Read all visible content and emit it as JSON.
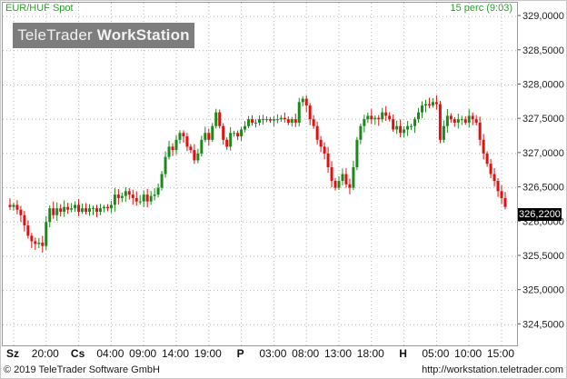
{
  "header": {
    "instrument": "EUR/HUF Spot",
    "interval_time": "15 perc (9:03)"
  },
  "logo": {
    "part1": "TeleTrader ",
    "part2": "WorkStation"
  },
  "footer": {
    "copyright": "© 2019 TeleTrader Software GmbH",
    "url": "http://workstation.teletrader.com"
  },
  "colors": {
    "up": "#1a8a1a",
    "down": "#e01010",
    "grid": "#b4b4b4",
    "accent": "#2e9e2e"
  },
  "chart_data": {
    "type": "candlestick",
    "title": "EUR/HUF Spot",
    "interval": "15 perc",
    "ylim": [
      324.2,
      329.2
    ],
    "ytick_values": [
      324.5,
      325.0,
      325.5,
      326.0,
      326.5,
      327.0,
      327.5,
      328.0,
      328.5,
      329.0
    ],
    "ytick_labels": [
      "324,5000",
      "325,0000",
      "325,5000",
      "326,0000",
      "326,5000",
      "327,0000",
      "327,5000",
      "328,0000",
      "328,5000",
      "329,0000"
    ],
    "last_price": "326,2200",
    "xticks": [
      {
        "label": "Sz",
        "bold": true
      },
      {
        "label": "20:00",
        "bold": false
      },
      {
        "label": "Cs",
        "bold": true
      },
      {
        "label": "04:00",
        "bold": false
      },
      {
        "label": "09:00",
        "bold": false
      },
      {
        "label": "14:00",
        "bold": false
      },
      {
        "label": "19:00",
        "bold": false
      },
      {
        "label": "P",
        "bold": true
      },
      {
        "label": "03:00",
        "bold": false
      },
      {
        "label": "08:00",
        "bold": false
      },
      {
        "label": "13:00",
        "bold": false
      },
      {
        "label": "18:00",
        "bold": false
      },
      {
        "label": "H",
        "bold": true
      },
      {
        "label": "05:00",
        "bold": false
      },
      {
        "label": "10:00",
        "bold": false
      },
      {
        "label": "15:00",
        "bold": false
      }
    ],
    "price_path": [
      326.22,
      326.25,
      326.18,
      326.1,
      325.95,
      325.8,
      325.72,
      325.68,
      325.7,
      325.65,
      326.0,
      326.2,
      326.1,
      326.2,
      326.15,
      326.22,
      326.18,
      326.2,
      326.25,
      326.15,
      326.2,
      326.15,
      326.2,
      326.2,
      326.15,
      326.2,
      326.22,
      326.2,
      326.25,
      326.4,
      326.35,
      326.38,
      326.45,
      326.4,
      326.35,
      326.3,
      326.3,
      326.4,
      326.3,
      326.38,
      326.4,
      326.5,
      326.7,
      326.95,
      327.1,
      327.05,
      327.2,
      327.3,
      327.25,
      327.1,
      327.05,
      326.9,
      327.0,
      327.2,
      327.3,
      327.2,
      327.4,
      327.6,
      327.4,
      327.2,
      327.1,
      327.3,
      327.3,
      327.25,
      327.35,
      327.4,
      327.5,
      327.45,
      327.45,
      327.5,
      327.5,
      327.5,
      327.48,
      327.5,
      327.5,
      327.52,
      327.5,
      327.45,
      327.5,
      327.45,
      327.75,
      327.8,
      327.7,
      327.5,
      327.4,
      327.2,
      327.1,
      327.0,
      326.8,
      326.6,
      326.5,
      326.6,
      326.7,
      326.55,
      326.5,
      326.8,
      327.2,
      327.4,
      327.5,
      327.55,
      327.5,
      327.52,
      327.5,
      327.6,
      327.55,
      327.5,
      327.35,
      327.4,
      327.3,
      327.35,
      327.4,
      327.4,
      327.5,
      327.6,
      327.7,
      327.72,
      327.7,
      327.75,
      327.72,
      327.2,
      327.4,
      327.55,
      327.5,
      327.45,
      327.5,
      327.5,
      327.45,
      327.55,
      327.5,
      327.45,
      327.2,
      327.0,
      326.85,
      326.7,
      326.6,
      326.45,
      326.35,
      326.22
    ]
  }
}
